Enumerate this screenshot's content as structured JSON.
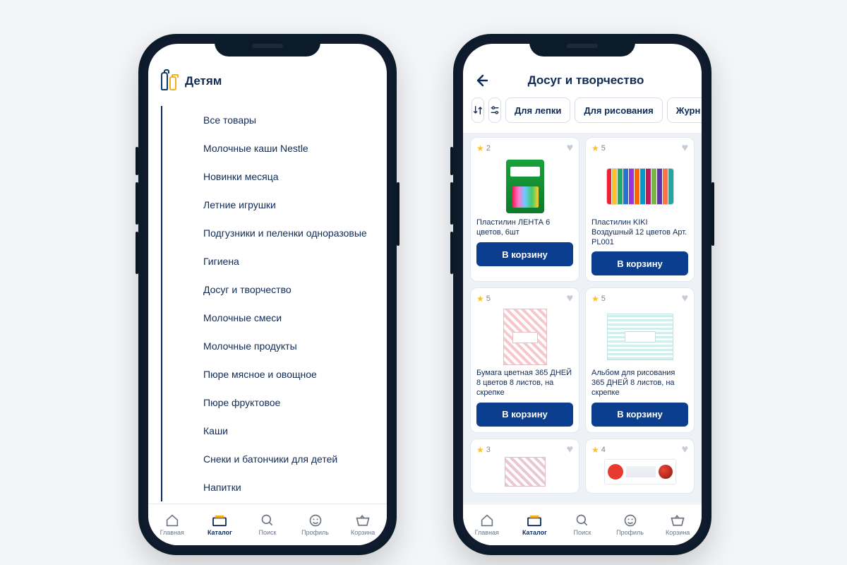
{
  "left": {
    "header": {
      "title": "Детям"
    },
    "categories": [
      "Все товары",
      "Молочные каши Nestle",
      "Новинки месяца",
      "Летние игрушки",
      "Подгузники и пеленки одноразовые",
      "Гигиена",
      "Досуг и творчество",
      "Молочные смеси",
      "Молочные продукты",
      "Пюре мясное и овощное",
      "Пюре фруктовое",
      "Каши",
      "Снеки и батончики для детей",
      "Напитки"
    ]
  },
  "right": {
    "header": {
      "title": "Досуг и творчество"
    },
    "filters": {
      "chips": [
        "Для лепки",
        "Для рисования",
        "Журн"
      ]
    },
    "cart_label": "В корзину",
    "products": [
      {
        "rating": "2",
        "name": "Пластилин ЛЕНТА 6 цветов, 6шт"
      },
      {
        "rating": "5",
        "name": "Пластилин KIKI Воздушный 12 цветов Арт. PL001"
      },
      {
        "rating": "5",
        "name": "Бумага цветная 365 ДНЕЙ 8 цветов 8 листов, на скрепке"
      },
      {
        "rating": "5",
        "name": "Альбом для рисования 365 ДНЕЙ 8 листов, на скрепке"
      },
      {
        "rating": "3",
        "name": ""
      },
      {
        "rating": "4",
        "name": ""
      }
    ]
  },
  "nav": {
    "items": [
      {
        "label": "Главная"
      },
      {
        "label": "Каталог"
      },
      {
        "label": "Поиск"
      },
      {
        "label": "Профиль"
      },
      {
        "label": "Корзина"
      }
    ]
  },
  "colors": {
    "brand": "#0b3e8e",
    "accent": "#ffc026"
  }
}
